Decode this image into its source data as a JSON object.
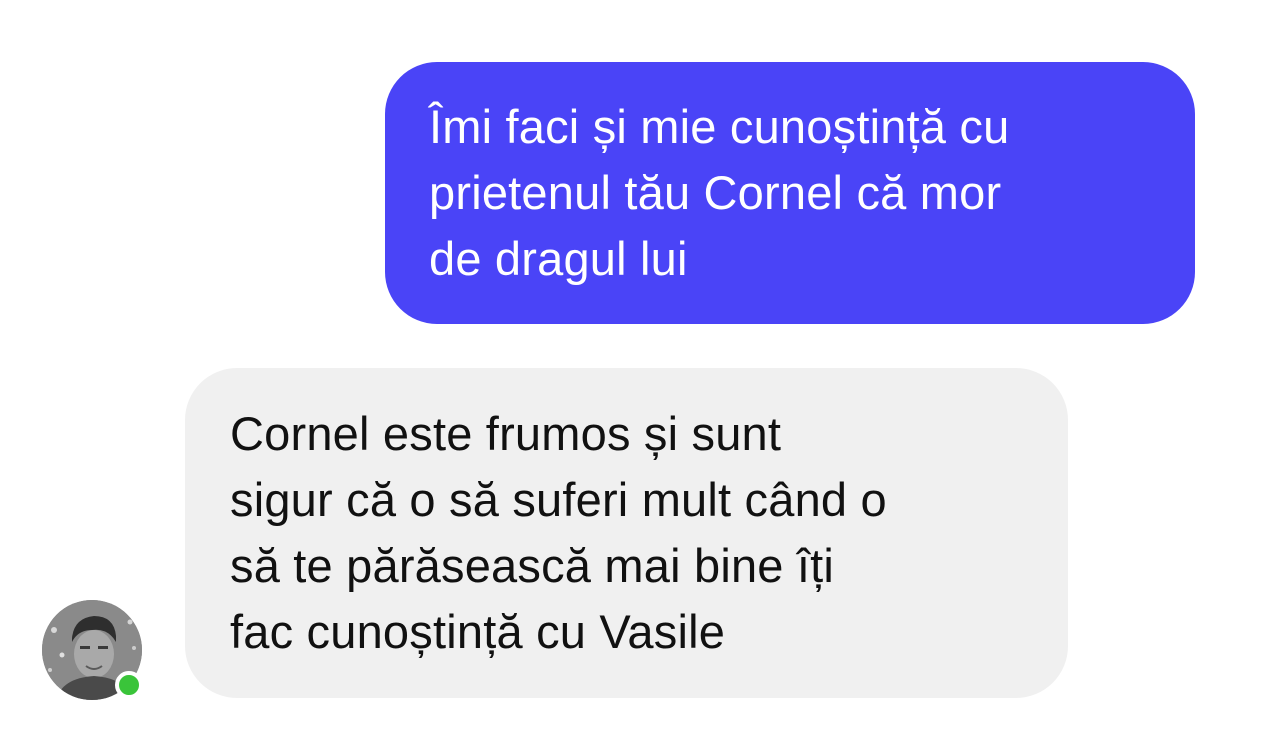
{
  "messages": [
    {
      "direction": "outgoing",
      "lines": [
        "Îmi faci și mie cunoștință cu",
        "prietenul tău Cornel că mor",
        "de dragul lui"
      ]
    },
    {
      "direction": "incoming",
      "lines": [
        "Cornel este frumos și sunt",
        "sigur că o să suferi mult când o",
        "să te părăsească mai bine îți",
        "fac cunoștință cu Vasile"
      ]
    }
  ],
  "contact": {
    "online": true
  },
  "colors": {
    "outgoing_bubble": "#4a44f7",
    "incoming_bubble": "#f0f0f0",
    "online_indicator": "#3ac43a"
  }
}
